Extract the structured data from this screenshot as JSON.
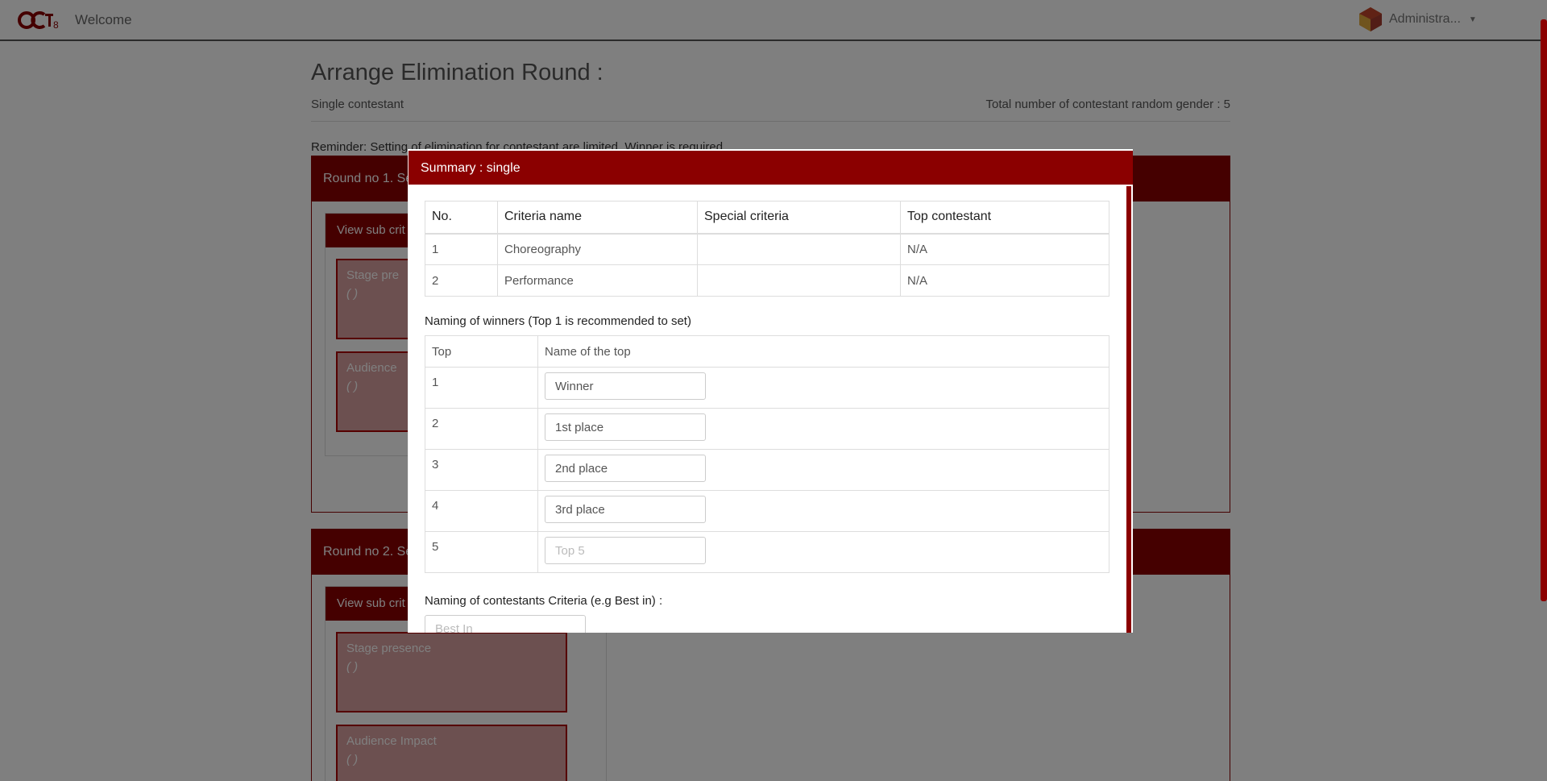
{
  "nav": {
    "title": "Welcome",
    "user": "Administra...",
    "logo_text": "OCT8"
  },
  "page": {
    "title": "Arrange Elimination Round :",
    "mode": "Single contestant",
    "total": "Total number of contestant random gender : 5",
    "reminder": "Reminder: Setting of elimination for contestant are limited. Winner is required."
  },
  "rounds": [
    {
      "head": "Round no 1. Se",
      "view_sub": "View sub crit",
      "crit1": "Stage pre",
      "crit1_score": "( )",
      "crit2": "Audience",
      "crit2_score": "( )"
    },
    {
      "head": "Round no 2. Se",
      "view_sub": "View sub crit",
      "crit1": "Stage presence",
      "crit1_score": "( )",
      "crit2": "Audience Impact",
      "crit2_score": "( )"
    }
  ],
  "modal": {
    "title": "Summary : single",
    "criteria_headers": [
      "No.",
      "Criteria name",
      "Special criteria",
      "Top contestant"
    ],
    "criteria_rows": [
      [
        "1",
        "Choreography",
        "",
        "N/A"
      ],
      [
        "2",
        "Performance",
        "",
        "N/A"
      ]
    ],
    "winners_label": "Naming of winners (Top 1 is recommended to set)",
    "winners_headers": [
      "Top",
      "Name of the top"
    ],
    "winners_rows": [
      {
        "top": "1",
        "value": "Winner",
        "placeholder": ""
      },
      {
        "top": "2",
        "value": "1st place",
        "placeholder": ""
      },
      {
        "top": "3",
        "value": "2nd place",
        "placeholder": ""
      },
      {
        "top": "4",
        "value": "3rd place",
        "placeholder": ""
      },
      {
        "top": "5",
        "value": "",
        "placeholder": "Top 5"
      }
    ],
    "contestants_label": "Naming of contestants Criteria (e.g Best in) :",
    "best_in_placeholder": "Best In"
  }
}
